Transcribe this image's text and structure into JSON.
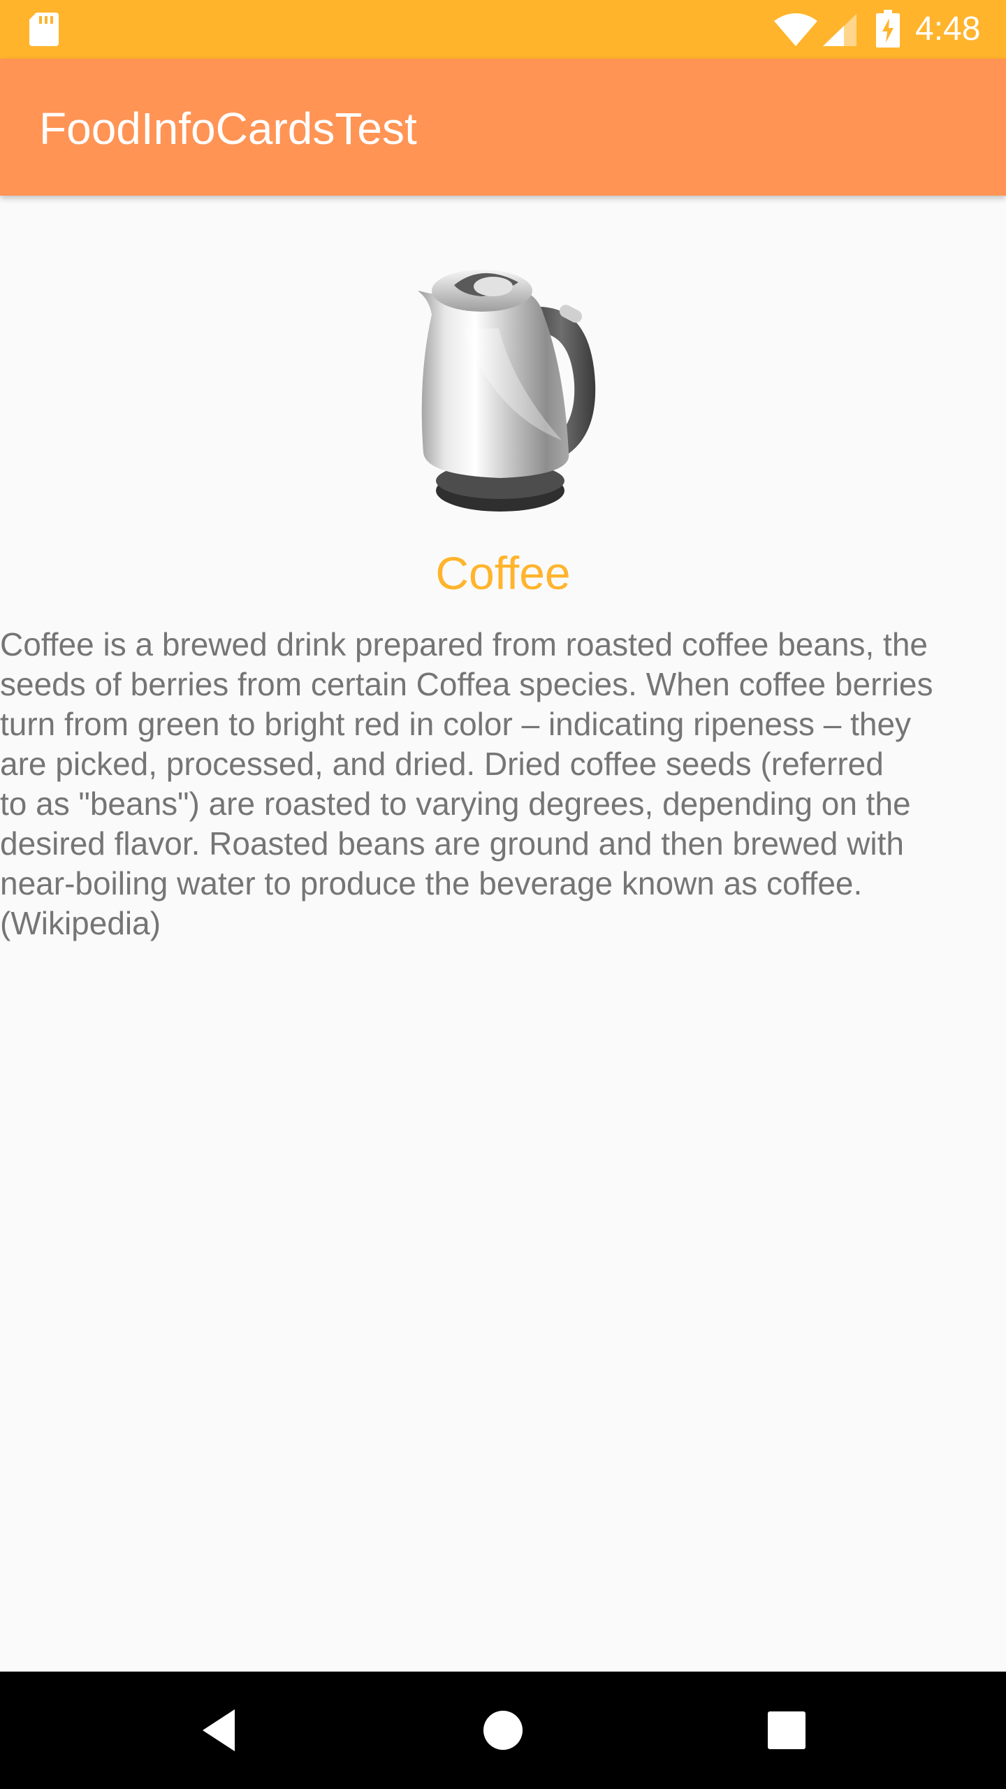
{
  "status_bar": {
    "time": "4:48",
    "background_color": "#ffb42c",
    "icons": [
      "sd-card-icon",
      "wifi-icon",
      "cell-signal-icon",
      "battery-charging-icon"
    ]
  },
  "app_bar": {
    "title": "FoodInfoCardsTest",
    "background_color": "#ff9455"
  },
  "food_card": {
    "image_icon": "kettle-icon",
    "name": "Coffee",
    "name_color": "#ffb42c",
    "description": "Coffee is a brewed drink prepared from roasted coffee beans, the\nseeds of berries from certain Coffea species. When coffee berries\nturn from green to bright red in color – indicating ripeness – they\nare picked, processed, and dried. Dried coffee seeds (referred\nto as \"beans\") are roasted to varying degrees, depending on the\ndesired flavor. Roasted beans are ground and then brewed with\nnear-boiling water to produce the beverage known as coffee.\n(Wikipedia)"
  },
  "nav_bar": {
    "buttons": [
      "back-icon",
      "home-icon",
      "recents-icon"
    ]
  }
}
